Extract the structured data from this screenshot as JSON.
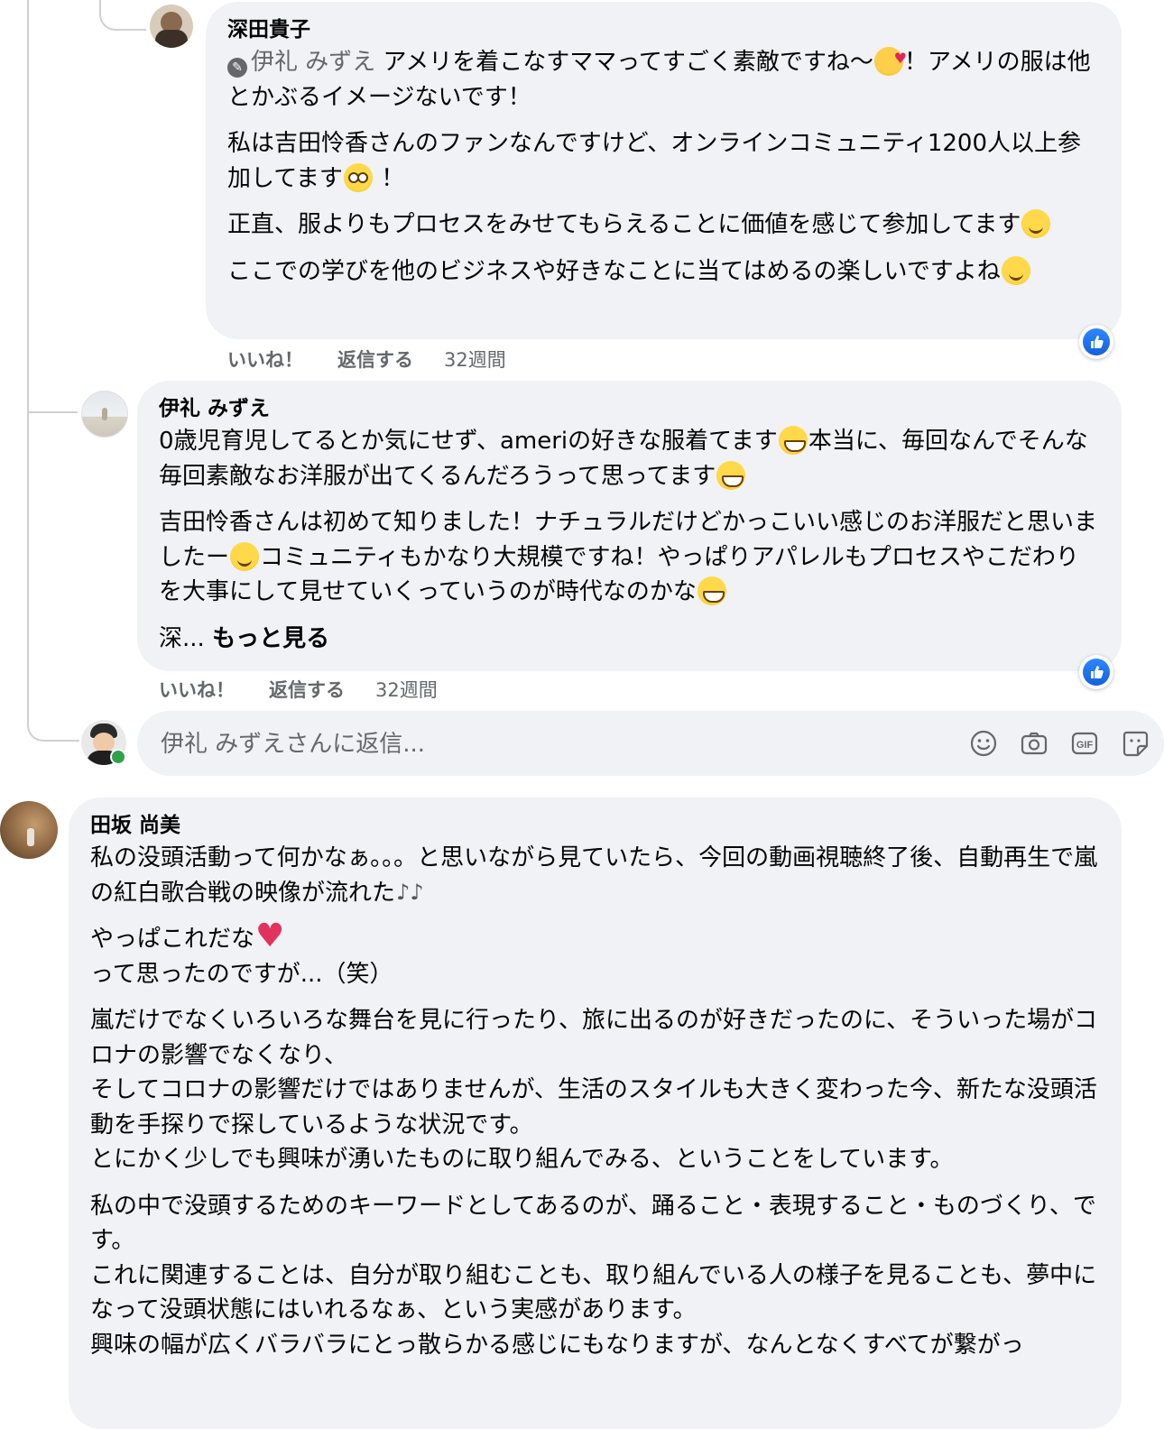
{
  "comments": [
    {
      "author": "深田貴子",
      "mention": "伊礼 みずえ",
      "paragraphs": [
        {
          "parts": [
            " アメリを着こなすママってすごく素敵ですね〜",
            "！アメリの服は他とかぶるイメージないです！"
          ],
          "emojis": [
            "love"
          ]
        },
        {
          "parts": [
            "私は吉田怜香さんのファンなんですけど、オンラインコミュニティ1200人以上参加してます",
            "！"
          ],
          "emojis": [
            "flushed"
          ]
        },
        {
          "parts": [
            "正直、服よりもプロセスをみせてもらえることに価値を感じて参加してます",
            ""
          ],
          "emojis": [
            "smile"
          ]
        },
        {
          "parts": [
            "ここでの学びを他のビジネスや好きなことに当てはめるの楽しいですよね",
            ""
          ],
          "emojis": [
            "smile"
          ]
        }
      ],
      "actions": {
        "like": "いいね！",
        "reply": "返信する",
        "time": "32週間"
      }
    },
    {
      "author": "伊礼 みずえ",
      "paragraphs": [
        {
          "parts": [
            "0歳児育児してるとか気にせず、ameriの好きな服着てます",
            "本当に、毎回なんでそんな毎回素敵なお洋服が出てくるんだろうって思ってます",
            ""
          ],
          "emojis": [
            "grin",
            "grin"
          ]
        },
        {
          "parts": [
            "吉田怜香さんは初めて知りました！ナチュラルだけどかっこいい感じのお洋服だと思いましたー",
            "コミュニティもかなり大規模ですね！やっぱりアパレルもプロセスやこだわりを大事にして見せていくっていうのが時代なのかな",
            ""
          ],
          "emojis": [
            "smile",
            "grin"
          ]
        }
      ],
      "truncated": "深...",
      "see_more": "もっと見る",
      "actions": {
        "like": "いいね！",
        "reply": "返信する",
        "time": "32週間"
      }
    }
  ],
  "reply_box": {
    "placeholder": "伊礼 みずえさんに返信...",
    "tools": [
      "emoji-icon",
      "camera-icon",
      "gif-icon",
      "sticker-icon"
    ],
    "gif_label": "GIF"
  },
  "third_comment": {
    "author": "田坂 尚美",
    "paragraphs": [
      {
        "lines": [
          "私の没頭活動って何かなぁ。。。と思いながら見ていたら、今回の動画視聴終了後、自動再生で嵐の紅白歌合戦の映像が流れた"
        ],
        "emoji_end": "notes"
      },
      {
        "lines": [
          "やっぱこれだな"
        ],
        "emoji_end": "heart",
        "tail": "って思ったのですが...（笑）"
      },
      {
        "lines": [
          "嵐だけでなくいろいろな舞台を見に行ったり、旅に出るのが好きだったのに、そういった場がコロナの影響でなくなり、",
          "そしてコロナの影響だけではありませんが、生活のスタイルも大きく変わった今、新たな没頭活動を手探りで探しているような状況です。",
          "とにかく少しでも興味が湧いたものに取り組んでみる、ということをしています。"
        ]
      },
      {
        "lines": [
          "私の中で没頭するためのキーワードとしてあるのが、踊ること・表現すること・ものづくり、です。",
          "これに関連することは、自分が取り組むことも、取り組んでいる人の様子を見ることも、夢中になって没頭状態にはいれるなぁ、という実感があります。",
          "興味の幅が広くバラバラにとっ散らかる感じにもなりますが、なんとなくすべてが繋がっ"
        ]
      }
    ]
  },
  "colors": {
    "bubble": "#f0f2f5",
    "secondary_text": "#65676b",
    "like_blue": "#1877f2",
    "online": "#31a24c"
  }
}
